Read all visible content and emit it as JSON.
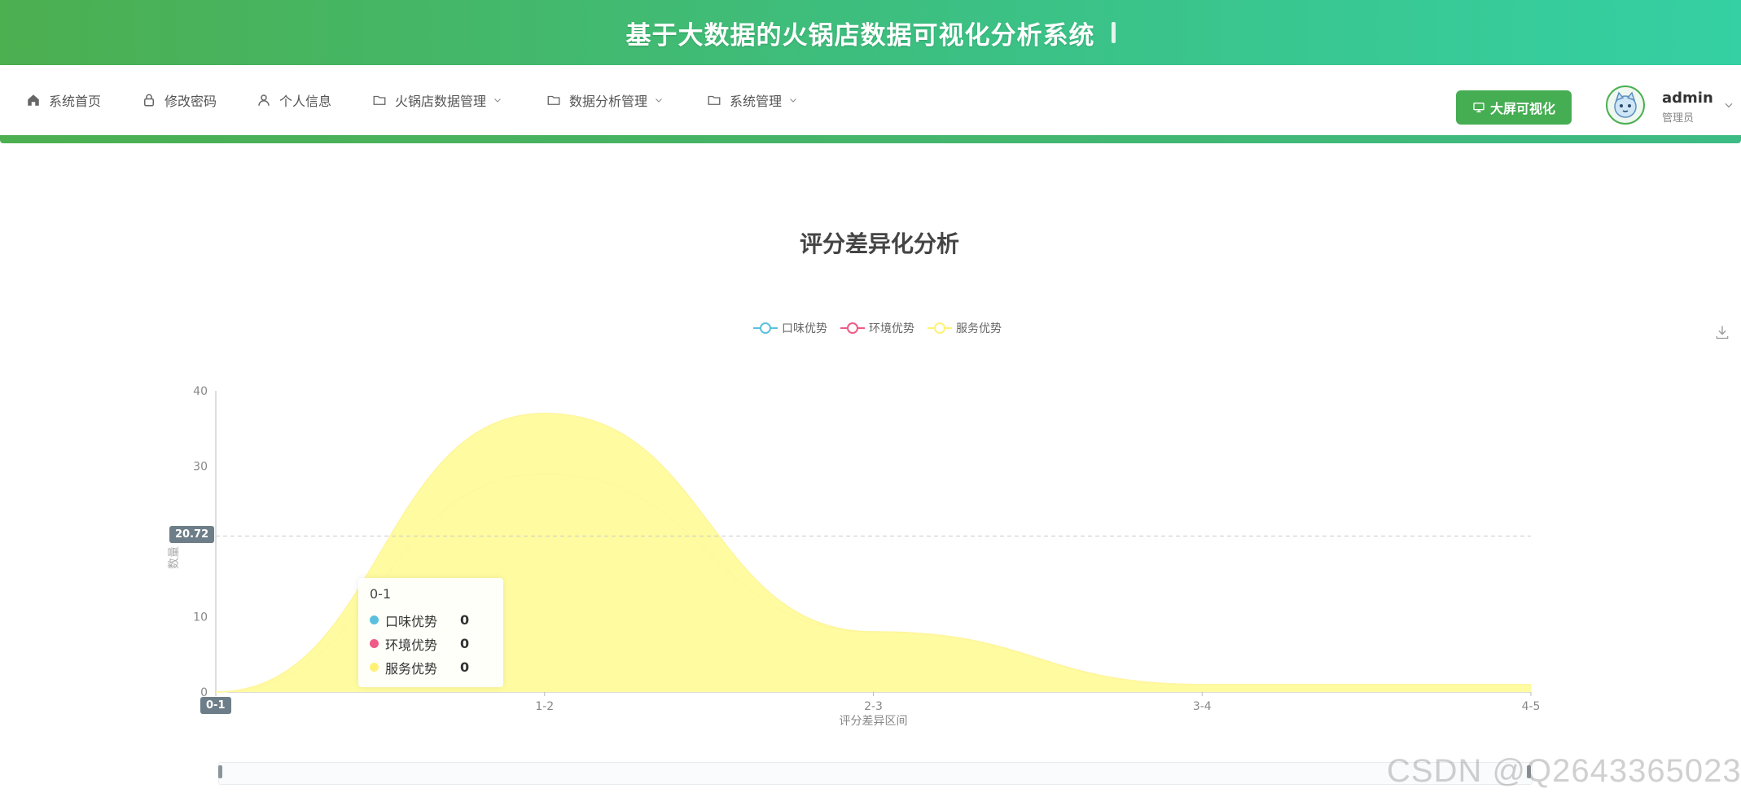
{
  "header": {
    "title": "基于大数据的火锅店数据可视化分析系统"
  },
  "nav": {
    "items": [
      {
        "label": "系统首页",
        "icon": "home-icon"
      },
      {
        "label": "修改密码",
        "icon": "lock-icon"
      },
      {
        "label": "个人信息",
        "icon": "user-icon"
      },
      {
        "label": "火锅店数据管理",
        "icon": "folder-icon",
        "dropdown": true
      },
      {
        "label": "数据分析管理",
        "icon": "folder-icon",
        "dropdown": true
      },
      {
        "label": "系统管理",
        "icon": "folder-icon",
        "dropdown": true
      }
    ],
    "big_screen_label": "大屏可视化",
    "user": {
      "name": "admin",
      "role": "管理员"
    }
  },
  "colors": {
    "accent": "#4caf50",
    "taste": "#5bc0de",
    "environment": "#ef5b85",
    "service": "#fff176"
  },
  "chart_data": {
    "type": "area",
    "title": "评分差异化分析",
    "xlabel": "评分差异区间",
    "ylabel": "数量",
    "categories": [
      "0-1",
      "1-2",
      "2-3",
      "3-4",
      "4-5"
    ],
    "ylim": [
      0,
      40
    ],
    "yticks": [
      0,
      10,
      30,
      40
    ],
    "stacked": true,
    "smooth": true,
    "legend_position": "top-center",
    "series": [
      {
        "name": "口味优势",
        "values": [
          0,
          0,
          0,
          0,
          0
        ],
        "color": "#5bc0de"
      },
      {
        "name": "环境优势",
        "values": [
          0,
          29,
          8,
          1,
          1
        ],
        "color": "#ef5b85"
      },
      {
        "name": "服务优势",
        "values": [
          0,
          8,
          0,
          0,
          0
        ],
        "color": "#fff176"
      }
    ],
    "crosshair": {
      "y_value_label": "20.72",
      "x_label": "0-1"
    },
    "tooltip": {
      "title": "0-1",
      "rows": [
        {
          "name": "口味优势",
          "value": "0"
        },
        {
          "name": "环境优势",
          "value": "0"
        },
        {
          "name": "服务优势",
          "value": "0"
        }
      ]
    }
  },
  "watermark": "CSDN @Q2643365023"
}
